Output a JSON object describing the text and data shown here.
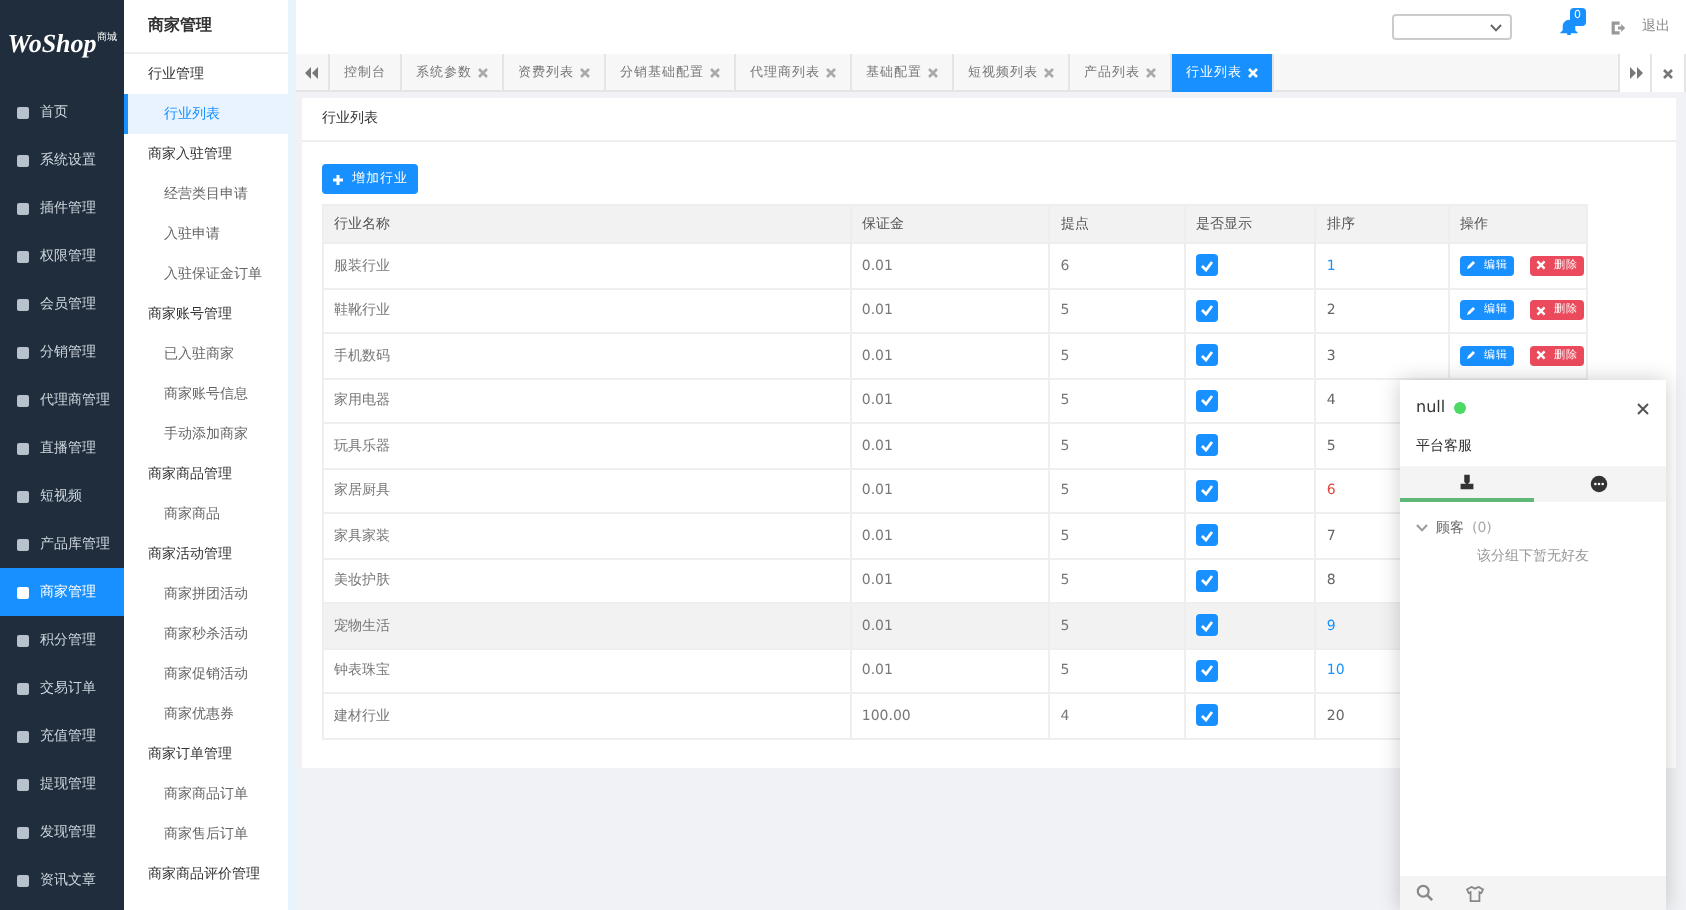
{
  "logo": {
    "text": "WoShop",
    "tag": "商城"
  },
  "sidebar": {
    "items": [
      {
        "label": "首页",
        "selected": false
      },
      {
        "label": "系统设置",
        "selected": false
      },
      {
        "label": "插件管理",
        "selected": false
      },
      {
        "label": "权限管理",
        "selected": false
      },
      {
        "label": "会员管理",
        "selected": false
      },
      {
        "label": "分销管理",
        "selected": false
      },
      {
        "label": "代理商管理",
        "selected": false
      },
      {
        "label": "直播管理",
        "selected": false
      },
      {
        "label": "短视频",
        "selected": false
      },
      {
        "label": "产品库管理",
        "selected": false
      },
      {
        "label": "商家管理",
        "selected": true
      },
      {
        "label": "积分管理",
        "selected": false
      },
      {
        "label": "交易订单",
        "selected": false
      },
      {
        "label": "充值管理",
        "selected": false
      },
      {
        "label": "提现管理",
        "selected": false
      },
      {
        "label": "发现管理",
        "selected": false
      },
      {
        "label": "资讯文章",
        "selected": false
      }
    ]
  },
  "submenu": {
    "title": "商家管理",
    "groups": [
      {
        "label": "行业管理",
        "children": [
          {
            "label": "行业列表",
            "selected": true
          }
        ]
      },
      {
        "label": "商家入驻管理",
        "children": [
          {
            "label": "经营类目申请",
            "selected": false
          },
          {
            "label": "入驻申请",
            "selected": false
          },
          {
            "label": "入驻保证金订单",
            "selected": false
          }
        ]
      },
      {
        "label": "商家账号管理",
        "children": [
          {
            "label": "已入驻商家",
            "selected": false
          },
          {
            "label": "商家账号信息",
            "selected": false
          },
          {
            "label": "手动添加商家",
            "selected": false
          }
        ]
      },
      {
        "label": "商家商品管理",
        "children": [
          {
            "label": "商家商品",
            "selected": false
          }
        ]
      },
      {
        "label": "商家活动管理",
        "children": [
          {
            "label": "商家拼团活动",
            "selected": false
          },
          {
            "label": "商家秒杀活动",
            "selected": false
          },
          {
            "label": "商家促销活动",
            "selected": false
          },
          {
            "label": "商家优惠券",
            "selected": false
          }
        ]
      },
      {
        "label": "商家订单管理",
        "children": [
          {
            "label": "商家商品订单",
            "selected": false
          },
          {
            "label": "商家售后订单",
            "selected": false
          }
        ]
      },
      {
        "label": "商家商品评价管理"
      }
    ]
  },
  "header": {
    "badge": "0",
    "logout": "退出"
  },
  "tabs": [
    {
      "label": "控制台",
      "closable": false,
      "selected": false
    },
    {
      "label": "系统参数",
      "closable": true,
      "selected": false
    },
    {
      "label": "资费列表",
      "closable": true,
      "selected": false
    },
    {
      "label": "分销基础配置",
      "closable": true,
      "selected": false
    },
    {
      "label": "代理商列表",
      "closable": true,
      "selected": false
    },
    {
      "label": "基础配置",
      "closable": true,
      "selected": false
    },
    {
      "label": "短视频列表",
      "closable": true,
      "selected": false
    },
    {
      "label": "产品列表",
      "closable": true,
      "selected": false
    },
    {
      "label": "行业列表",
      "closable": true,
      "selected": true
    }
  ],
  "card": {
    "title": "行业列表",
    "add_button": "增加行业"
  },
  "table": {
    "columns": [
      "行业名称",
      "保证金",
      "提点",
      "是否显示",
      "排序",
      "操作"
    ],
    "rows": [
      {
        "name": "服装行业",
        "deposit": "0.01",
        "commission": "6",
        "shown": true,
        "sort": "1",
        "color": "#1890ff",
        "highlighted": false,
        "actions": [
          "编辑",
          "删除"
        ]
      },
      {
        "name": "鞋靴行业",
        "deposit": "0.01",
        "commission": "5",
        "shown": true,
        "sort": "2",
        "color": "#666666",
        "highlighted": false,
        "actions": [
          "编辑",
          "删除"
        ]
      },
      {
        "name": "手机数码",
        "deposit": "0.01",
        "commission": "5",
        "shown": true,
        "sort": "3",
        "color": "#666666",
        "highlighted": false,
        "actions": [
          "编辑",
          "删除"
        ]
      },
      {
        "name": "家用电器",
        "deposit": "0.01",
        "commission": "5",
        "shown": true,
        "sort": "4",
        "color": "#666666",
        "highlighted": false
      },
      {
        "name": "玩具乐器",
        "deposit": "0.01",
        "commission": "5",
        "shown": true,
        "sort": "5",
        "color": "#666666",
        "highlighted": false
      },
      {
        "name": "家居厨具",
        "deposit": "0.01",
        "commission": "5",
        "shown": true,
        "sort": "6",
        "color": "#e0463c",
        "highlighted": false
      },
      {
        "name": "家具家装",
        "deposit": "0.01",
        "commission": "5",
        "shown": true,
        "sort": "7",
        "color": "#666666",
        "highlighted": false
      },
      {
        "name": "美妆护肤",
        "deposit": "0.01",
        "commission": "5",
        "shown": true,
        "sort": "8",
        "color": "#666666",
        "highlighted": false
      },
      {
        "name": "宠物生活",
        "deposit": "0.01",
        "commission": "5",
        "shown": true,
        "sort": "9",
        "color": "#1890ff",
        "highlighted": true
      },
      {
        "name": "钟表珠宝",
        "deposit": "0.01",
        "commission": "5",
        "shown": true,
        "sort": "10",
        "color": "#1890ff",
        "highlighted": false
      },
      {
        "name": "建材行业",
        "deposit": "100.00",
        "commission": "4",
        "shown": true,
        "sort": "20",
        "color": "#666666",
        "highlighted": false
      }
    ]
  },
  "chat": {
    "name": "null",
    "online": true,
    "subtitle": "平台客服",
    "tabs": [
      {
        "kind": "contacts",
        "selected": true
      },
      {
        "kind": "messages",
        "selected": false
      }
    ],
    "group": {
      "label": "顾客",
      "count": "(0)",
      "expanded": true
    },
    "empty": "该分组下暂无好友"
  }
}
